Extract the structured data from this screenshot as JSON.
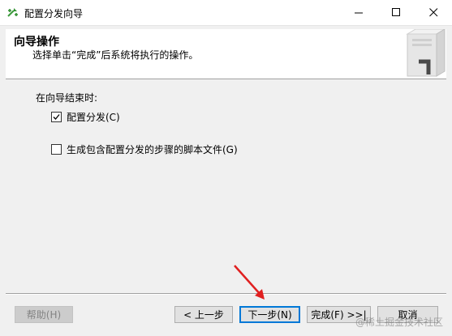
{
  "window": {
    "title": "配置分发向导",
    "icons": {
      "app": "wizard-icon",
      "minimize": "minimize-icon",
      "maximize": "maximize-icon",
      "close": "close-icon"
    }
  },
  "header": {
    "title": "向导操作",
    "subtitle": "选择单击“完成”后系统将执行的操作。",
    "graphic": "server-graphic"
  },
  "body": {
    "group_label": "在向导结束时:",
    "options": [
      {
        "label": "配置分发(C)",
        "checked": true
      },
      {
        "label": "生成包含配置分发的步骤的脚本文件(G)",
        "checked": false
      }
    ]
  },
  "buttons": {
    "help": "帮助(H)",
    "back": "< 上一步",
    "next": "下一步(N)",
    "finish": "完成(F) >>|",
    "cancel": "取消"
  },
  "annotation": {
    "arrow_color": "#e02020"
  },
  "watermark": "@稀土掘金技术社区"
}
